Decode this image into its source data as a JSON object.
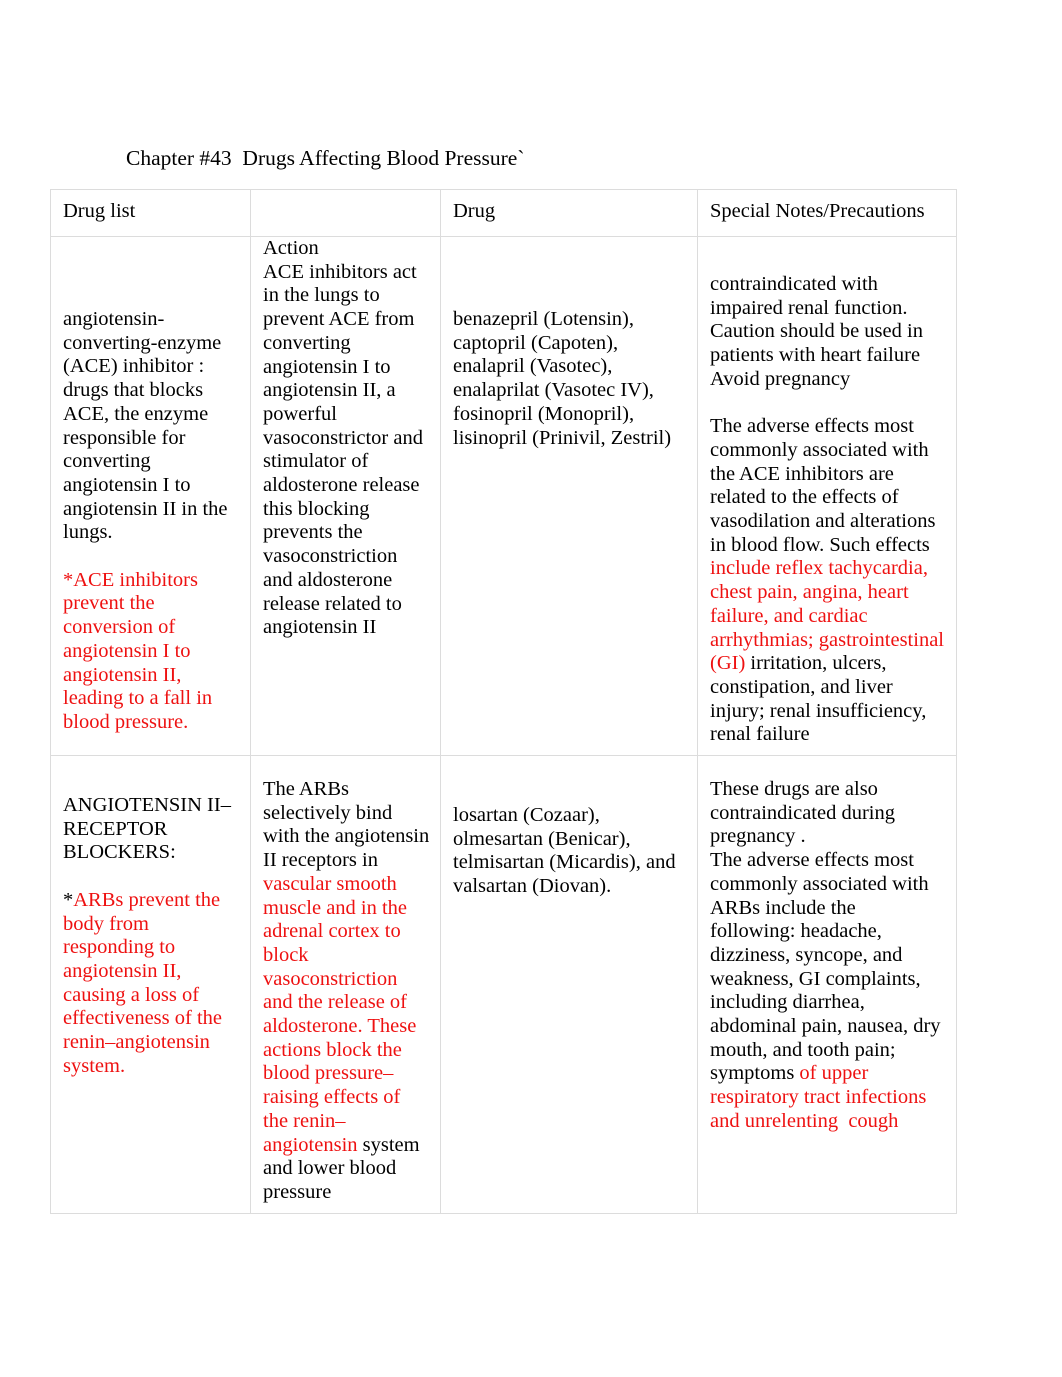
{
  "document": {
    "title": "Chapter #43  Drugs Affecting Blood Pressure`"
  },
  "table": {
    "headers": {
      "col1": "Drug list",
      "col2": "Drug",
      "col3": "Special Notes/Precautions",
      "action_label": "Action"
    },
    "rows": [
      {
        "id": "ace-inhibitors",
        "drug_list": {
          "black": "angiotensin-converting-enzyme (ACE) inhibitor  : drugs that blocks ACE, the enzyme responsible for converting angiotensin I to angiotensin II in the lungs.",
          "red": "*ACE inhibitors prevent the conversion of angiotensin I to angiotensin II, leading to a fall in blood pressure."
        },
        "action": {
          "black": "ACE inhibitors act in the lungs to prevent ACE from converting angiotensin I to angiotensin II, a powerful vasoconstrictor and stimulator of aldosterone release this blocking prevents the vasoconstriction and aldosterone release related to angiotensin II"
        },
        "drug": "benazepril (Lotensin), captopril (Capoten), enalapril (Vasotec), enalaprilat (Vasotec IV), fosinopril (Monopril), lisinopril (Prinivil, Zestril)",
        "notes": {
          "part1_black": "contraindicated with impaired renal function. Caution should be used in patients with heart failure Avoid pregnancy",
          "part2_black": "The adverse effects most commonly associated with the ACE inhibitors are related to the effects of vasodilation and alterations in blood flow. Such effects ",
          "part2_red": "include reflex tachycardia, chest pain, angina, heart failure, and cardiac arrhythmias; gastrointestinal (GI)",
          "part2_black_tail": " irritation, ulcers, constipation, and liver injury; renal insufficiency, renal failure"
        }
      },
      {
        "id": "angiotensin-ii-receptor-blockers",
        "drug_list": {
          "black_heading": "ANGIOTENSIN II–RECEPTOR BLOCKERS:",
          "asterisk": "*",
          "red": "ARBs prevent the body from responding to angiotensin II, causing a loss of effectiveness of the renin–angiotensin system."
        },
        "action": {
          "black_lead": "The ARBs selectively bind with the angiotensin II receptors  in ",
          "red": "vascular smooth muscle and in the adrenal cortex to block vasoconstriction and the release of aldosterone. These actions block the blood pressure–raising effects of the renin–angiotensin",
          "black_tail": " system and lower blood pressure"
        },
        "drug": "losartan (Cozaar), olmesartan (Benicar), telmisartan (Micardis), and valsartan (Diovan).",
        "notes": {
          "black": "These drugs are also contraindicated during pregnancy .\nThe adverse effects most commonly associated with ARBs include the following: headache, dizziness, syncope, and weakness, GI complaints, including diarrhea, abdominal pain, nausea, dry mouth, and tooth pain; symptoms ",
          "red": "of upper respiratory tract infections and unrelenting  cough"
        }
      }
    ]
  },
  "colors": {
    "text": "#000000",
    "highlight_red": "#ee1111",
    "border": "#dcdcdc",
    "page_background": "#ffffff"
  }
}
